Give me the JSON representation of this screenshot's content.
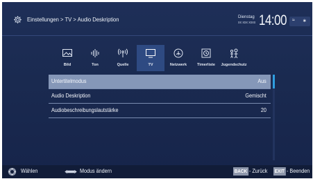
{
  "header": {
    "breadcrumb": "Einstellungen > TV > Audio Deskription",
    "day": "Dienstag",
    "date": "xx xxx xxxx",
    "time": "14:00",
    "status_icons": [
      "wifi-icon",
      "bluetooth-icon"
    ]
  },
  "categories": [
    {
      "label": "Bild",
      "icon": "picture-icon"
    },
    {
      "label": "Ton",
      "icon": "sound-icon"
    },
    {
      "label": "Quelle",
      "icon": "source-icon"
    },
    {
      "label": "TV",
      "icon": "tv-icon",
      "active": true
    },
    {
      "label": "Netzwerk",
      "icon": "network-icon"
    },
    {
      "label": "Timerliste",
      "icon": "timer-list-icon"
    },
    {
      "label": "Jugendschutz",
      "icon": "parental-control-icon"
    }
  ],
  "menu": {
    "rows": [
      {
        "name": "Untertitelmodus",
        "value": "Aus",
        "selected": true
      },
      {
        "name": "Audio Deskription",
        "value": "Gemischt"
      },
      {
        "name": "Audiobeschreibungslautstärke",
        "value": "20"
      }
    ]
  },
  "footer": {
    "select_label": "Wählen",
    "mode_label": "Modus ändern",
    "back_key": "BACK",
    "back_label": "- Zurück",
    "exit_key": "EXIT",
    "exit_label": "- Beenden"
  },
  "colors": {
    "background": "#1a2a50",
    "selected_row": "#8597b8",
    "active_tab": "#2e4a82",
    "scroll_accent": "#2f9ee0"
  }
}
